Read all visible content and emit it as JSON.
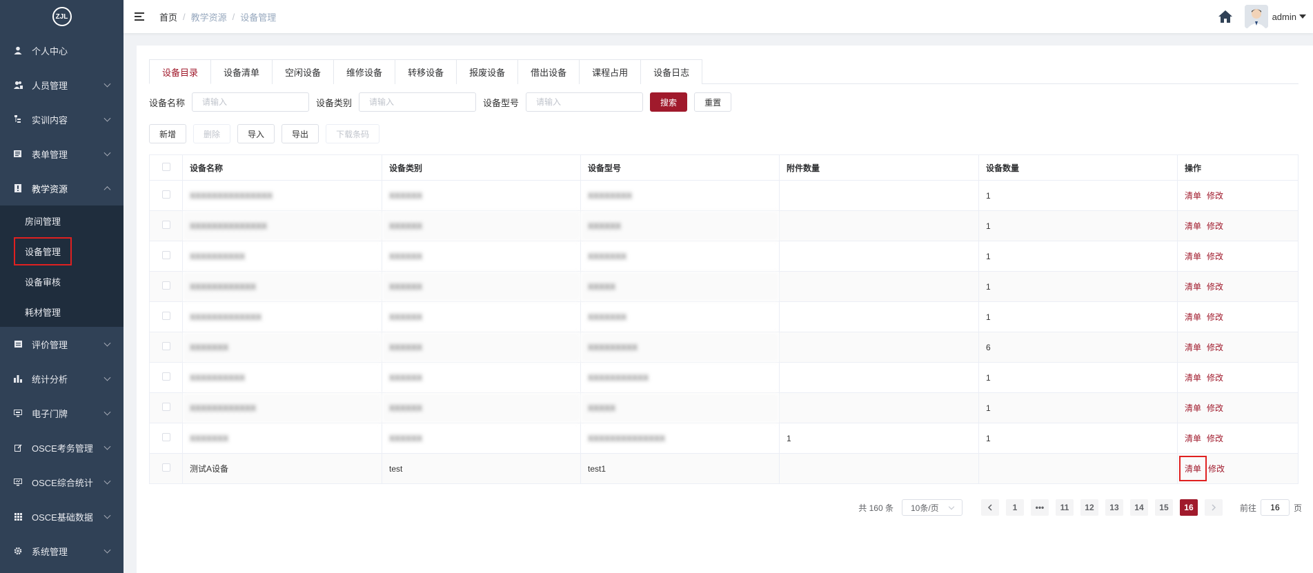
{
  "logo": {
    "text": "ZJL"
  },
  "sidebar": {
    "items": [
      {
        "label": "个人中心",
        "icon": "user-icon"
      },
      {
        "label": "人员管理",
        "icon": "people-icon"
      },
      {
        "label": "实训内容",
        "icon": "tree-icon"
      },
      {
        "label": "表单管理",
        "icon": "form-icon"
      },
      {
        "label": "教学资源",
        "icon": "book-icon"
      },
      {
        "label": "评价管理",
        "icon": "rate-icon"
      },
      {
        "label": "统计分析",
        "icon": "chart-icon"
      },
      {
        "label": "电子门牌",
        "icon": "monitor-icon"
      },
      {
        "label": "OSCE考务管理",
        "icon": "edit-icon"
      },
      {
        "label": "OSCE综合统计",
        "icon": "screen-icon"
      },
      {
        "label": "OSCE基础数据",
        "icon": "grid-icon"
      },
      {
        "label": "系统管理",
        "icon": "gear-icon"
      }
    ],
    "submenu": [
      "房间管理",
      "设备管理",
      "设备审核",
      "耗材管理"
    ]
  },
  "header": {
    "breadcrumb": [
      "首页",
      "教学资源",
      "设备管理"
    ],
    "user": "admin"
  },
  "tabs": [
    "设备目录",
    "设备清单",
    "空闲设备",
    "维修设备",
    "转移设备",
    "报废设备",
    "借出设备",
    "课程占用",
    "设备日志"
  ],
  "filters": {
    "name_label": "设备名称",
    "category_label": "设备类别",
    "model_label": "设备型号",
    "placeholder": "请输入",
    "search": "搜索",
    "reset": "重置"
  },
  "actions": {
    "add": "新增",
    "delete": "删除",
    "import": "导入",
    "export": "导出",
    "download": "下载条码"
  },
  "table": {
    "headers": [
      "设备名称",
      "设备类别",
      "设备型号",
      "附件数量",
      "设备数量",
      "操作"
    ],
    "ops": {
      "list": "清单",
      "edit": "修改"
    },
    "rows": [
      {
        "name": "XXXXXXXXXXXXXXX",
        "category": "XXXXXX",
        "model": "XXXXXXXX",
        "attach": "",
        "qty": "1"
      },
      {
        "name": "XXXXXXXXXXXXXX",
        "category": "XXXXXX",
        "model": "XXXXXX",
        "attach": "",
        "qty": "1"
      },
      {
        "name": "XXXXXXXXXX",
        "category": "XXXXXX",
        "model": "XXXXXXX",
        "attach": "",
        "qty": "1"
      },
      {
        "name": "XXXXXXXXXXXX",
        "category": "XXXXXX",
        "model": "XXXXX",
        "attach": "",
        "qty": "1"
      },
      {
        "name": "XXXXXXXXXXXXX",
        "category": "XXXXXX",
        "model": "XXXXXXX",
        "attach": "",
        "qty": "1"
      },
      {
        "name": "XXXXXXX",
        "category": "XXXXXX",
        "model": "XXXXXXXXX",
        "attach": "",
        "qty": "6"
      },
      {
        "name": "XXXXXXXXXX",
        "category": "XXXXXX",
        "model": "XXXXXXXXXXX",
        "attach": "",
        "qty": "1"
      },
      {
        "name": "XXXXXXXXXXXX",
        "category": "XXXXXX",
        "model": "XXXXX",
        "attach": "",
        "qty": "1"
      },
      {
        "name": "XXXXXXX",
        "category": "XXXXXX",
        "model": "XXXXXXXXXXXXXX",
        "attach": "1",
        "qty": "1"
      },
      {
        "name": "测试A设备",
        "category": "test",
        "model": "test1",
        "attach": "",
        "qty": ""
      }
    ]
  },
  "pagination": {
    "total": "共 160 条",
    "page_size": "10条/页",
    "pages": [
      "1",
      "•••",
      "11",
      "12",
      "13",
      "14",
      "15",
      "16"
    ],
    "current": "16",
    "goto_label": "前往",
    "goto_value": "16",
    "goto_suffix": "页"
  },
  "colors": {
    "accent": "#a01a2c",
    "sidebar": "#304156",
    "submenu": "#1f2d3d",
    "highlight": "#e02020"
  }
}
